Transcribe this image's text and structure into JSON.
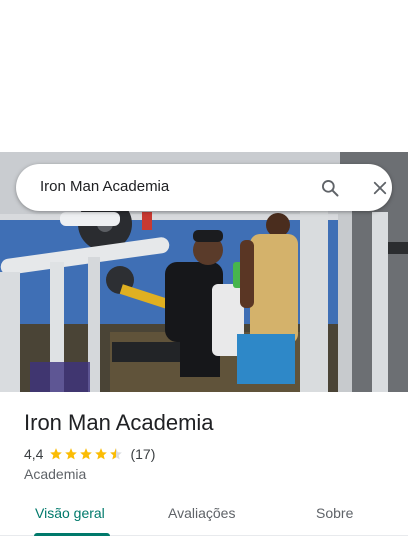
{
  "search": {
    "query": "Iron Man Academia",
    "search_icon": "search-icon",
    "close_icon": "close-icon"
  },
  "photo": {
    "description_icon": "place-photo"
  },
  "place": {
    "name": "Iron Man Academia",
    "rating": "4,4",
    "rating_value": 4.4,
    "reviews": "(17)",
    "category": "Academia",
    "star_color": "#fbbc04"
  },
  "tabs": [
    {
      "label": "Visão geral",
      "active": true
    },
    {
      "label": "Avaliações",
      "active": false
    },
    {
      "label": "Sobre",
      "active": false
    }
  ],
  "colors": {
    "accent": "#00796b",
    "text": "#202124",
    "secondary_text": "#5f6368"
  }
}
